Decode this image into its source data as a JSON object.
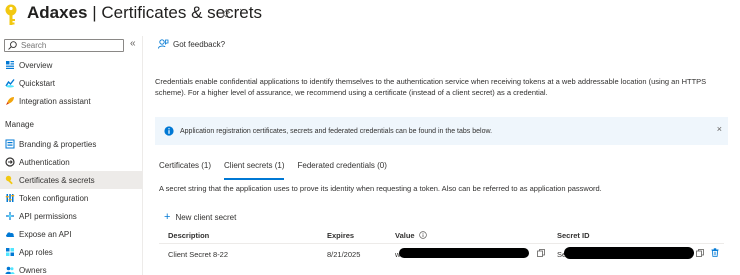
{
  "header": {
    "app_name": "Adaxes",
    "separator": " | ",
    "page_title": "Certificates & secrets",
    "more": "···"
  },
  "sidebar": {
    "search_placeholder": "Search",
    "collapse": "«",
    "items_top": [
      {
        "label": "Overview",
        "icon": "overview-icon"
      },
      {
        "label": "Quickstart",
        "icon": "quickstart-icon"
      },
      {
        "label": "Integration assistant",
        "icon": "rocket-icon"
      }
    ],
    "section_label": "Manage",
    "items_manage": [
      {
        "label": "Branding & properties",
        "icon": "branding-icon"
      },
      {
        "label": "Authentication",
        "icon": "authentication-icon"
      },
      {
        "label": "Certificates & secrets",
        "icon": "key-icon",
        "active": true
      },
      {
        "label": "Token configuration",
        "icon": "token-icon"
      },
      {
        "label": "API permissions",
        "icon": "api-permissions-icon"
      },
      {
        "label": "Expose an API",
        "icon": "cloud-icon"
      },
      {
        "label": "App roles",
        "icon": "app-roles-icon"
      },
      {
        "label": "Owners",
        "icon": "owners-icon"
      }
    ]
  },
  "toolbar": {
    "feedback_label": "Got feedback?"
  },
  "main": {
    "description": "Credentials enable confidential applications to identify themselves to the authentication service when receiving tokens at a web addressable location (using an HTTPS scheme). For a higher level of assurance, we recommend using a certificate (instead of a client secret) as a credential.",
    "info_text": "Application registration certificates, secrets and federated credentials can be found in the tabs below.",
    "info_close": "×",
    "tabs": [
      {
        "label": "Certificates (1)"
      },
      {
        "label": "Client secrets (1)",
        "active": true
      },
      {
        "label": "Federated credentials (0)"
      }
    ],
    "tab_description": "A secret string that the application uses to prove its identity when requesting a token. Also can be referred to as application password.",
    "add_label": "New client secret",
    "table": {
      "headers": {
        "description": "Description",
        "expires": "Expires",
        "value": "Value",
        "secret_id": "Secret ID"
      },
      "rows": [
        {
          "description": "Client Secret 8-22",
          "expires": "8/21/2025",
          "value_prefix": "w",
          "secret_prefix": "Se"
        }
      ]
    }
  },
  "colors": {
    "accent": "#0078d4",
    "key_gold": "#f2c811",
    "info_bg": "#eff6fc",
    "active_nav": "#edebe9",
    "delete_red": "#0078d4"
  }
}
